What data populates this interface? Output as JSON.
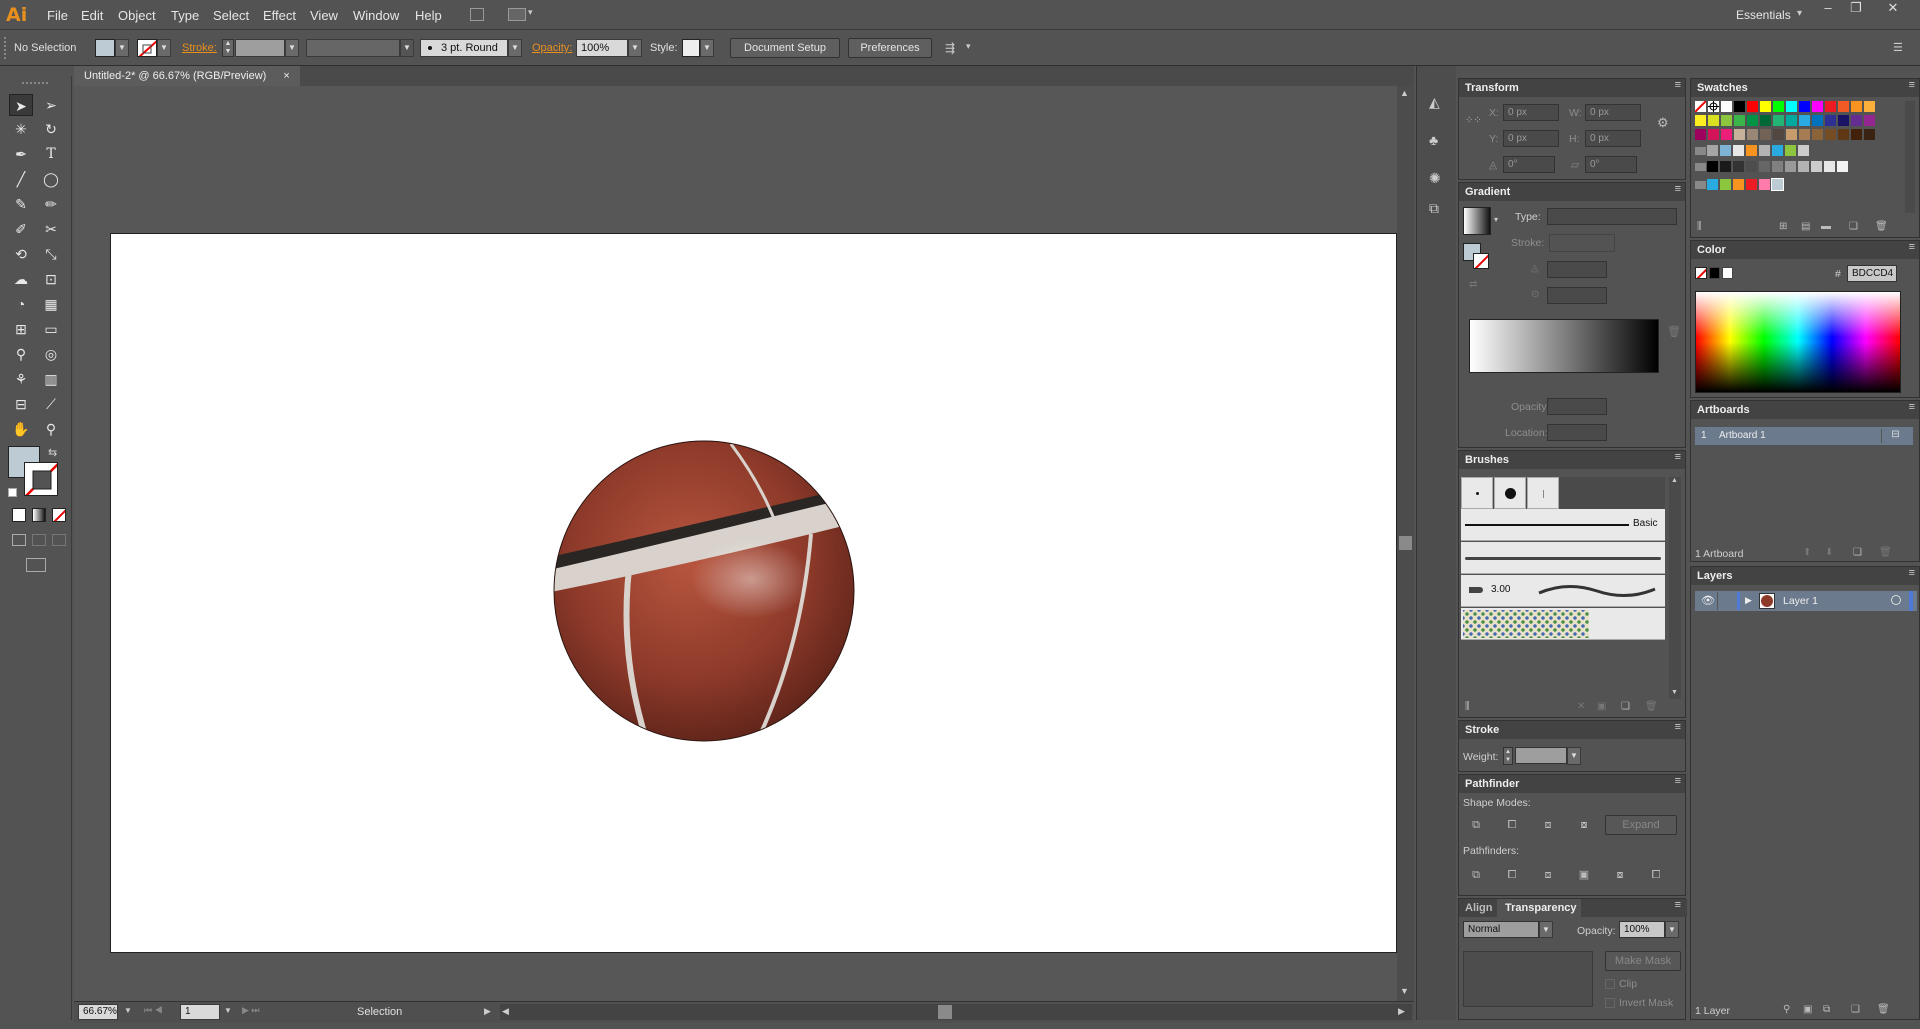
{
  "app": {
    "logo": "Ai"
  },
  "menu": [
    "File",
    "Edit",
    "Object",
    "Type",
    "Select",
    "Effect",
    "View",
    "Window",
    "Help"
  ],
  "workspace": {
    "label": "Essentials",
    "arrow": "▾"
  },
  "window_controls": {
    "minimize": "–",
    "restore": "❐",
    "close": "✕"
  },
  "control_bar": {
    "selection_label": "No Selection",
    "stroke_label": "Stroke:",
    "brush_value": "3 pt. Round",
    "opacity_label": "Opacity:",
    "opacity_value": "100%",
    "style_label": "Style:",
    "document_setup": "Document Setup",
    "preferences": "Preferences"
  },
  "document_tab": {
    "title": "Untitled-2* @ 66.67% (RGB/Preview)",
    "close": "×"
  },
  "status_bar": {
    "zoom": "66.67%",
    "page": "1",
    "tool_name": "Selection"
  },
  "transform": {
    "title": "Transform",
    "x_label": "X:",
    "y_label": "Y:",
    "w_label": "W:",
    "h_label": "H:",
    "x": "0 px",
    "y": "0 px",
    "w": "0 px",
    "h": "0 px",
    "angle": "0°",
    "shear": "0°"
  },
  "gradient": {
    "title": "Gradient",
    "type_label": "Type:",
    "stroke_label": "Stroke:",
    "opacity_label": "Opacity:",
    "location_label": "Location:"
  },
  "brushes": {
    "title": "Brushes",
    "basic_label": "Basic",
    "size_label": "3.00"
  },
  "stroke": {
    "title": "Stroke",
    "weight_label": "Weight:"
  },
  "pathfinder": {
    "title": "Pathfinder",
    "shape_modes_label": "Shape Modes:",
    "pathfinders_label": "Pathfinders:",
    "expand": "Expand"
  },
  "transparency": {
    "tab_align": "Align",
    "tab_transparency": "Transparency",
    "mode": "Normal",
    "opacity_label": "Opacity:",
    "opacity_value": "100%",
    "make_mask": "Make Mask",
    "clip": "Clip",
    "invert_mask": "Invert Mask"
  },
  "swatches": {
    "title": "Swatches"
  },
  "color": {
    "title": "Color",
    "hash": "#",
    "hex": "BDCCD4",
    "fill_color": "#bdccd4"
  },
  "artboards": {
    "title": "Artboards",
    "items": [
      {
        "num": "1",
        "name": "Artboard 1"
      }
    ],
    "count": "1 Artboard"
  },
  "layers": {
    "title": "Layers",
    "items": [
      {
        "name": "Layer 1"
      }
    ],
    "count": "1 Layer",
    "layer_color": "#4f79d6"
  }
}
